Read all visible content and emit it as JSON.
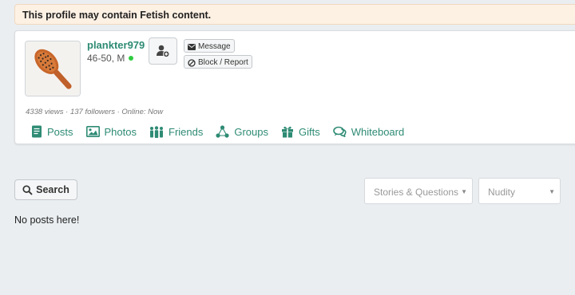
{
  "warning": {
    "text": "This profile may contain Fetish content."
  },
  "profile": {
    "username": "plankter979",
    "age_sex": "46-50, M",
    "online": true,
    "stats": "4338 views · 137 followers · Online: Now",
    "avatar_icon": "hairbrush-photo"
  },
  "actions": {
    "follow_icon": "add-user-icon",
    "message_label": "Message",
    "block_label": "Block / Report"
  },
  "nav": {
    "posts": "Posts",
    "photos": "Photos",
    "friends": "Friends",
    "groups": "Groups",
    "gifts": "Gifts",
    "whiteboard": "Whiteboard"
  },
  "toolbar": {
    "search_label": "Search",
    "type_filter": "Stories & Questions",
    "nudity_filter": "Nudity"
  },
  "content": {
    "empty_text": "No posts here!"
  },
  "colors": {
    "accent": "#2e8b74",
    "online": "#2ecc40",
    "warning_bg": "#fdf1e4"
  }
}
